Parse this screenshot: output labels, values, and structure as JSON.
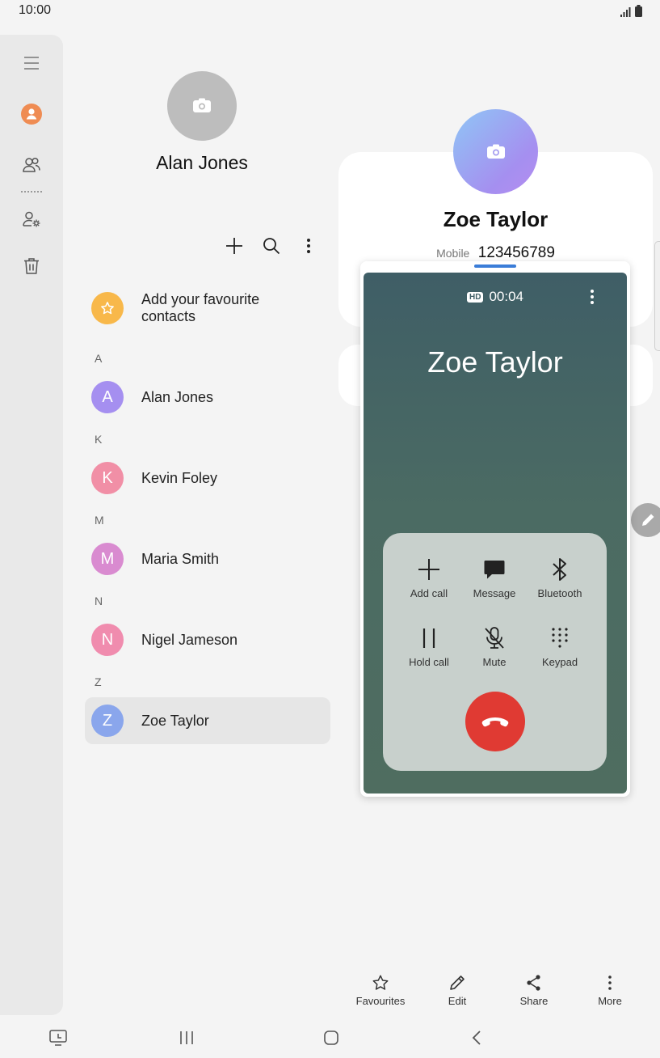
{
  "status_bar": {
    "time": "10:00",
    "icons": [
      "signal-icon",
      "battery-icon"
    ]
  },
  "nav_rail": {
    "items": [
      "menu-icon",
      "profile-icon",
      "contacts-icon",
      "manage-contacts-icon",
      "trash-icon"
    ]
  },
  "contact_list_header": {
    "name": "Alan Jones"
  },
  "toolbar": {
    "icons": [
      "add-icon",
      "search-icon",
      "more-icon"
    ]
  },
  "favourites": {
    "label": "Add your favourite contacts"
  },
  "sections": [
    {
      "letter": "A",
      "contacts": [
        {
          "initial": "A",
          "name": "Alan Jones",
          "color": "#a58ff0"
        }
      ]
    },
    {
      "letter": "K",
      "contacts": [
        {
          "initial": "K",
          "name": "Kevin Foley",
          "color": "#f18fa6"
        }
      ]
    },
    {
      "letter": "M",
      "contacts": [
        {
          "initial": "M",
          "name": "Maria Smith",
          "color": "#d98bd0"
        }
      ]
    },
    {
      "letter": "N",
      "contacts": [
        {
          "initial": "N",
          "name": "Nigel Jameson",
          "color": "#f08cae"
        }
      ]
    },
    {
      "letter": "Z",
      "contacts": [
        {
          "initial": "Z",
          "name": "Zoe Taylor",
          "color": "#8aa6ec"
        }
      ]
    }
  ],
  "detail": {
    "name": "Zoe Taylor",
    "phone_label": "Mobile",
    "phone_number": "123456789"
  },
  "call": {
    "hd_badge": "HD",
    "timer": "00:04",
    "caller_name": "Zoe Taylor",
    "buttons": {
      "add_call": "Add call",
      "message": "Message",
      "bluetooth": "Bluetooth",
      "hold_call": "Hold call",
      "mute": "Mute",
      "keypad": "Keypad"
    },
    "end_color": "#e03a33"
  },
  "bottom_actions": {
    "favourites": "Favourites",
    "edit": "Edit",
    "share": "Share",
    "more": "More"
  },
  "colors": {
    "rail_bg": "#e9e9e9",
    "call_bg": "#4b6b63",
    "accent": "#3b7dd8",
    "favourite": "#f8b84a"
  }
}
